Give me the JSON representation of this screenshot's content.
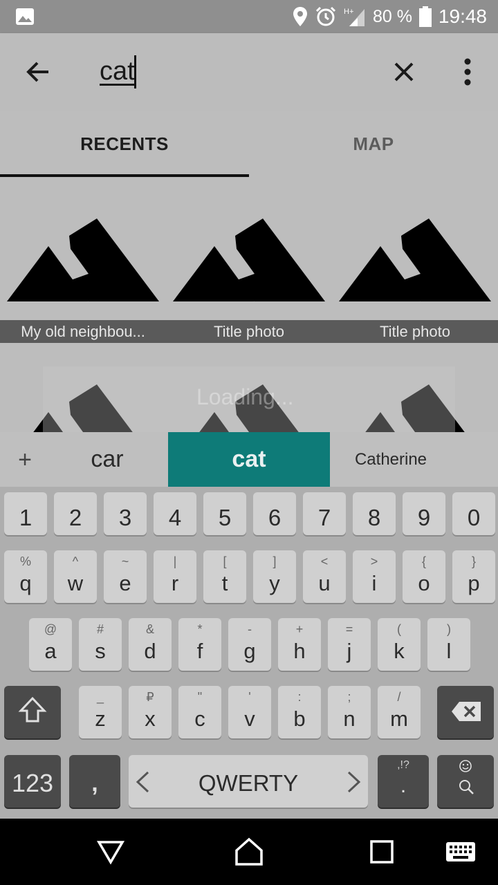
{
  "status_bar": {
    "battery": "80 %",
    "time": "19:48",
    "network": "H+"
  },
  "search": {
    "query": "cat"
  },
  "tabs": [
    {
      "label": "RECENTS"
    },
    {
      "label": "MAP"
    }
  ],
  "photos": [
    {
      "title": "My old neighbou..."
    },
    {
      "title": "Title photo"
    },
    {
      "title": "Title photo"
    }
  ],
  "loading_text": "Loading...",
  "suggestions": {
    "plus": "+",
    "items": [
      "car",
      "cat",
      "Catherine"
    ]
  },
  "keyboard": {
    "row_numbers": [
      "1",
      "2",
      "3",
      "4",
      "5",
      "6",
      "7",
      "8",
      "9",
      "0"
    ],
    "row1": [
      {
        "k": "q",
        "s": "%"
      },
      {
        "k": "w",
        "s": "^"
      },
      {
        "k": "e",
        "s": "~"
      },
      {
        "k": "r",
        "s": "|"
      },
      {
        "k": "t",
        "s": "["
      },
      {
        "k": "y",
        "s": "]"
      },
      {
        "k": "u",
        "s": "<"
      },
      {
        "k": "i",
        "s": ">"
      },
      {
        "k": "o",
        "s": "{"
      },
      {
        "k": "p",
        "s": "}"
      }
    ],
    "row2": [
      {
        "k": "a",
        "s": "@"
      },
      {
        "k": "s",
        "s": "#"
      },
      {
        "k": "d",
        "s": "&"
      },
      {
        "k": "f",
        "s": "*"
      },
      {
        "k": "g",
        "s": "-"
      },
      {
        "k": "h",
        "s": "+"
      },
      {
        "k": "j",
        "s": "="
      },
      {
        "k": "k",
        "s": "("
      },
      {
        "k": "l",
        "s": ")"
      }
    ],
    "row3": [
      {
        "k": "z",
        "s": "_"
      },
      {
        "k": "x",
        "s": "₽"
      },
      {
        "k": "c",
        "s": "\""
      },
      {
        "k": "v",
        "s": "'"
      },
      {
        "k": "b",
        "s": ":"
      },
      {
        "k": "n",
        "s": ";"
      },
      {
        "k": "m",
        "s": "/"
      }
    ],
    "symbols_label": "123",
    "comma": ",",
    "space_label": "QWERTY",
    "period": ".",
    "period_sub": ",!?"
  }
}
